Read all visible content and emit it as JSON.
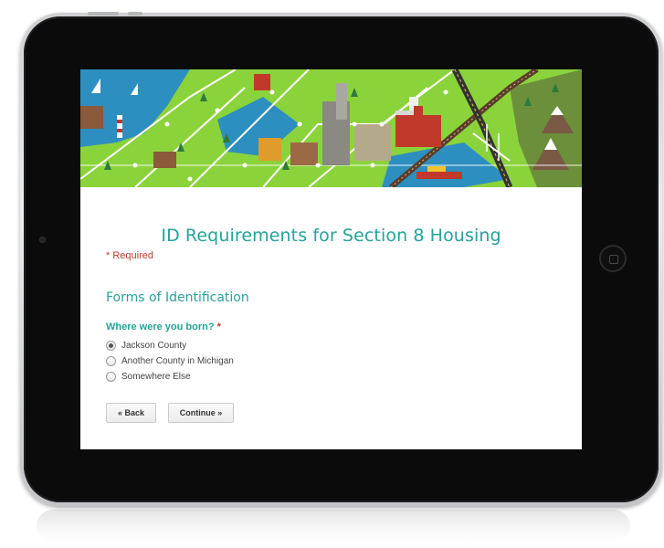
{
  "form": {
    "title": "ID Requirements for Section 8 Housing",
    "required_note": "* Required",
    "section_title": "Forms of Identification",
    "question": {
      "label": "Where were you born?",
      "required_marker": "*",
      "options": [
        {
          "label": "Jackson County",
          "selected": true
        },
        {
          "label": "Another County in Michigan",
          "selected": false
        },
        {
          "label": "Somewhere Else",
          "selected": false
        }
      ]
    },
    "buttons": {
      "back": "« Back",
      "continue": "Continue »"
    }
  },
  "colors": {
    "accent": "#24a39a",
    "required": "#c0392b",
    "banner_green": "#8bd33b",
    "water": "#2d8fbf"
  }
}
